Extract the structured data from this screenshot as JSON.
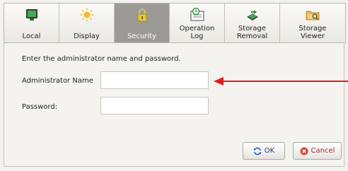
{
  "tabs": [
    {
      "label": "Local",
      "icon": "monitor-icon"
    },
    {
      "label": "Display",
      "icon": "sun-icon"
    },
    {
      "label": "Security",
      "icon": "padlock-icon",
      "active": true
    },
    {
      "label": "Operation\nLog",
      "icon": "clock-log-icon"
    },
    {
      "label": "Storage\nRemoval",
      "icon": "storage-removal-icon"
    },
    {
      "label": "Storage\nViewer",
      "icon": "folder-viewer-icon"
    }
  ],
  "form": {
    "prompt": "Enter the administrator name and password.",
    "admin_name_label": "Administrator Name",
    "admin_name_value": "",
    "password_label": "Password:",
    "password_value": ""
  },
  "buttons": {
    "ok_label": "OK",
    "cancel_label": "Cancel"
  },
  "colors": {
    "active_tab": "#9c9a95",
    "arrow": "#e01b1b",
    "ok_icon": "#2a64c9",
    "cancel_icon": "#d6453a"
  }
}
